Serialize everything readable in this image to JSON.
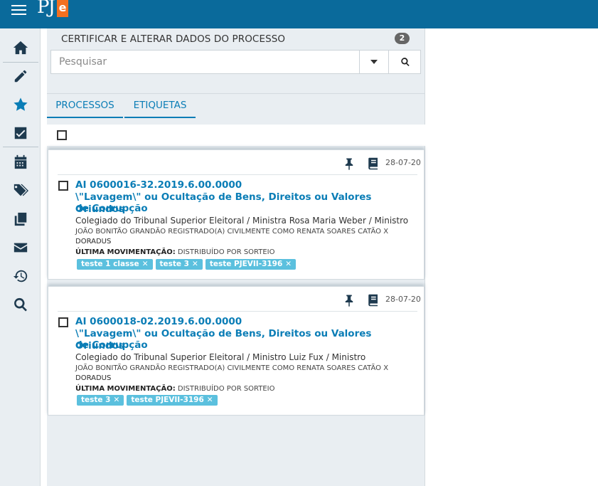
{
  "app": {
    "logo_text": "PJe"
  },
  "sidebar": {
    "items": [
      {
        "icon": "home-icon"
      },
      {
        "icon": "pencil-icon"
      },
      {
        "icon": "star-icon"
      },
      {
        "icon": "check-square-icon"
      },
      {
        "icon": "calendar-icon"
      },
      {
        "icon": "tags-icon"
      },
      {
        "icon": "copy-icon"
      },
      {
        "icon": "envelope-icon"
      },
      {
        "icon": "history-icon"
      },
      {
        "icon": "search-icon"
      }
    ]
  },
  "panel": {
    "title": "CERTIFICAR E ALTERAR DADOS DO PROCESSO",
    "count": "2",
    "search": {
      "placeholder": "Pesquisar",
      "value": ""
    },
    "tabs": [
      {
        "label": "PROCESSOS",
        "active": true
      },
      {
        "label": "ETIQUETAS",
        "active": false
      }
    ]
  },
  "processes": [
    {
      "date": "28-07-20",
      "number": "AI 0600016-32.2019.6.00.0000",
      "subject_line1": "\\\"Lavagem\\\" ou Ocultação de Bens, Direitos ou Valores Oriundos",
      "subject_line2": "de Corrupção",
      "organ": "Colegiado do Tribunal Superior Eleitoral / Ministra Rosa Maria Weber / Ministro",
      "parties_line1": "JOÃO BONITÃO GRANDÃO REGISTRADO(A) CIVILMENTE COMO RENATA SOARES CATÃO X DORADUS",
      "parties_line2": "DORADUS",
      "last_move_label": "ÚLTIMA MOVIMENTAÇÃO:",
      "last_move_value": "DISTRIBUÍDO POR SORTEIO",
      "tags": [
        "teste 1 classe",
        "teste 3",
        "teste PJEVII-3196"
      ]
    },
    {
      "date": "28-07-20",
      "number": "AI 0600018-02.2019.6.00.0000",
      "subject_line1": "\\\"Lavagem\\\" ou Ocultação de Bens, Direitos ou Valores Oriundos",
      "subject_line2": "de Corrupção",
      "organ": "Colegiado do Tribunal Superior Eleitoral / Ministro Luiz Fux / Ministro",
      "parties_line1": "JOÃO BONITÃO GRANDÃO REGISTRADO(A) CIVILMENTE COMO RENATA SOARES CATÃO X DORADUS",
      "parties_line2": "DORADUS",
      "last_move_label": "ÚLTIMA MOVIMENTAÇÃO:",
      "last_move_value": "DISTRIBUÍDO POR SORTEIO",
      "tags": [
        "teste 3",
        "teste PJEVII-3196"
      ]
    }
  ],
  "colors": {
    "topbar": "#0a6a9b",
    "link": "#0a7db6",
    "tag": "#5bc0de",
    "logo_accent": "#f37021"
  }
}
